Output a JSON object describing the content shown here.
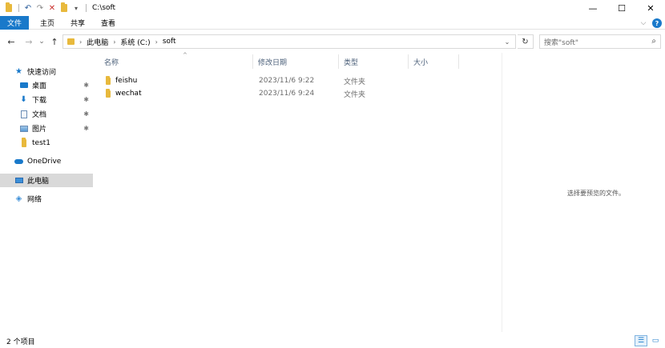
{
  "window": {
    "title": "C:\\soft",
    "controls": {
      "minimize": "—",
      "maximize": "☐",
      "close": "✕"
    }
  },
  "quick_access_toolbar": {
    "undo": "↶",
    "redo": "↷",
    "delete": "✕",
    "dropdown": "▾"
  },
  "ribbon": {
    "tabs": [
      {
        "label": "文件",
        "active": true
      },
      {
        "label": "主页",
        "active": false
      },
      {
        "label": "共享",
        "active": false
      },
      {
        "label": "查看",
        "active": false
      }
    ],
    "expand": "⌵",
    "help": "?"
  },
  "navigation": {
    "back": "←",
    "forward": "→",
    "recent": "⌄",
    "up": "↑"
  },
  "address": {
    "segments": [
      "此电脑",
      "系统 (C:)",
      "soft"
    ],
    "separator": "›",
    "dropdown": "⌄",
    "refresh": "↻"
  },
  "search": {
    "placeholder": "搜索\"soft\"",
    "icon": "⌕"
  },
  "sidebar": {
    "items": [
      {
        "label": "快速访问",
        "icon": "star-icon",
        "pinned": false
      },
      {
        "label": "桌面",
        "icon": "desktop-icon",
        "pinned": true
      },
      {
        "label": "下载",
        "icon": "download-icon",
        "pinned": true
      },
      {
        "label": "文档",
        "icon": "document-icon",
        "pinned": true
      },
      {
        "label": "图片",
        "icon": "pictures-icon",
        "pinned": true
      },
      {
        "label": "test1",
        "icon": "folder-icon",
        "pinned": false
      },
      {
        "label": "OneDrive",
        "icon": "cloud-icon",
        "pinned": false
      },
      {
        "label": "此电脑",
        "icon": "computer-icon",
        "pinned": false,
        "selected": true
      },
      {
        "label": "网络",
        "icon": "network-icon",
        "pinned": false
      }
    ],
    "pin_glyph": "📌"
  },
  "file_list": {
    "columns": [
      "名称",
      "修改日期",
      "类型",
      "大小"
    ],
    "sort_indicator": "^",
    "rows": [
      {
        "name": "feishu",
        "date": "2023/11/6 9:22",
        "type": "文件夹",
        "size": ""
      },
      {
        "name": "wechat",
        "date": "2023/11/6 9:24",
        "type": "文件夹",
        "size": ""
      }
    ]
  },
  "preview": {
    "text": "选择要预览的文件。"
  },
  "status": {
    "item_count": "2 个项目",
    "view_details": "☰",
    "view_icons": "▭"
  },
  "colors": {
    "accent": "#1979ca",
    "folder": "#e8b93c",
    "selected": "#d9d9d9"
  }
}
